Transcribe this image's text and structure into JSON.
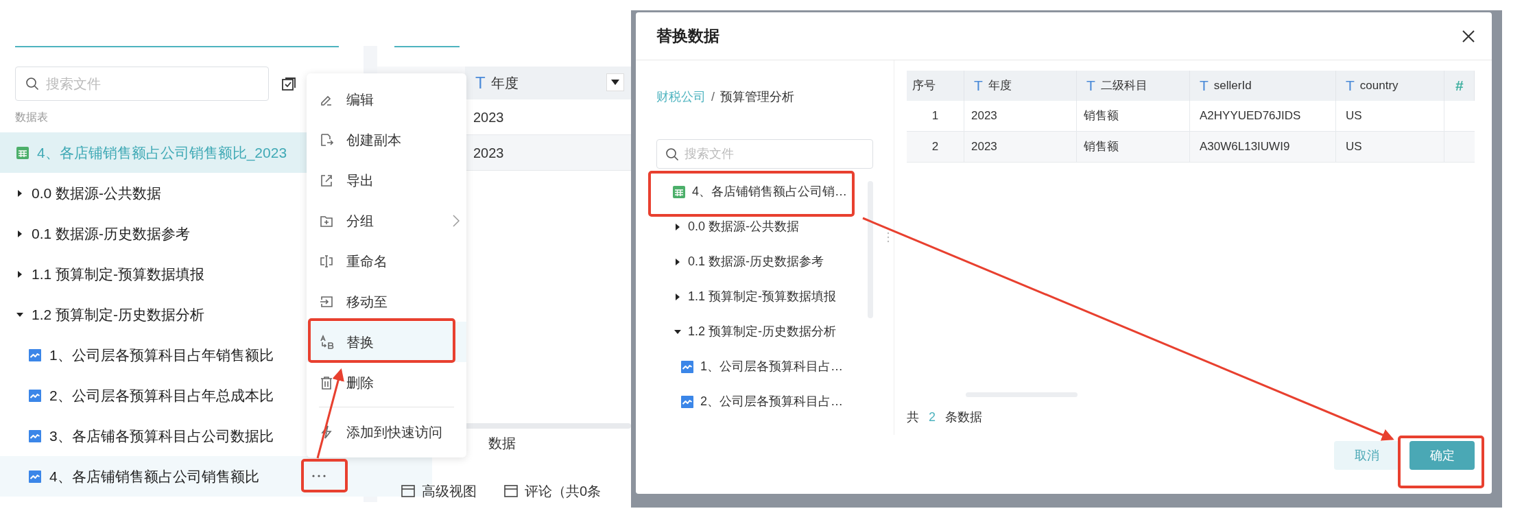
{
  "left_panel": {
    "search": {
      "placeholder": "搜索文件"
    },
    "section_label": "数据表",
    "tree": [
      {
        "label": "4、各店铺销售额占公司销售额比_2023",
        "kind": "table",
        "selected": true
      },
      {
        "label": "0.0 数据源-公共数据",
        "kind": "folder",
        "expanded": false
      },
      {
        "label": "0.1 数据源-历史数据参考",
        "kind": "folder",
        "expanded": false
      },
      {
        "label": "1.1 预算制定-预算数据填报",
        "kind": "folder",
        "expanded": false
      },
      {
        "label": "1.2 预算制定-历史数据分析",
        "kind": "folder",
        "expanded": true,
        "children": [
          {
            "label": "1、公司层各预算科目占年销售额比",
            "kind": "chart",
            "selected": false
          },
          {
            "label": "2、公司层各预算科目占年总成本比",
            "kind": "chart",
            "selected": false
          },
          {
            "label": "3、各店铺各预算科目占公司数据比",
            "kind": "chart",
            "selected": false
          },
          {
            "label": "4、各店铺销售额占公司销售额比",
            "kind": "chart",
            "selected": true
          }
        ]
      }
    ]
  },
  "middle_panel": {
    "table": {
      "columns": [
        {
          "type_icon": "T",
          "label": "年度"
        }
      ],
      "rows": [
        [
          "2023"
        ],
        [
          "2023"
        ]
      ]
    },
    "partial_text": "数据",
    "bottom_tabs": [
      "高级视图",
      "评论（共0条"
    ]
  },
  "context_menu": {
    "items": [
      {
        "label": "编辑",
        "kind": "edit",
        "selected": false
      },
      {
        "label": "创建副本",
        "kind": "copy",
        "selected": false
      },
      {
        "label": "导出",
        "kind": "export",
        "selected": false
      },
      {
        "label": "分组",
        "kind": "group",
        "selected": false,
        "submenu": true
      },
      {
        "label": "重命名",
        "kind": "rename",
        "selected": false
      },
      {
        "label": "移动至",
        "kind": "move",
        "selected": false
      },
      {
        "label": "替换",
        "kind": "replace",
        "selected": true
      },
      {
        "label": "删除",
        "kind": "delete",
        "selected": false
      },
      {
        "label": "添加到快速访问",
        "kind": "quick_access",
        "selected": false,
        "divider_before": true
      }
    ]
  },
  "dialog": {
    "title": "替换数据",
    "breadcrumb": [
      "财税公司",
      "预算管理分析"
    ],
    "breadcrumb_separator": "/",
    "search": {
      "placeholder": "搜索文件"
    },
    "tree": [
      {
        "label": "4、各店铺销售额占公司销…",
        "kind": "table"
      },
      {
        "label": "0.0 数据源-公共数据",
        "kind": "folder",
        "expanded": false
      },
      {
        "label": "0.1 数据源-历史数据参考",
        "kind": "folder",
        "expanded": false
      },
      {
        "label": "1.1 预算制定-预算数据填报",
        "kind": "folder",
        "expanded": false
      },
      {
        "label": "1.2 预算制定-历史数据分析",
        "kind": "folder",
        "expanded": true,
        "children": [
          {
            "label": "1、公司层各预算科目占…",
            "kind": "chart"
          },
          {
            "label": "2、公司层各预算科目占…",
            "kind": "chart"
          }
        ]
      }
    ],
    "table": {
      "columns": [
        {
          "label": "序号"
        },
        {
          "type_icon": "T",
          "label": "年度"
        },
        {
          "type_icon": "T",
          "label": "二级科目"
        },
        {
          "type_icon": "T",
          "label": "sellerId"
        },
        {
          "type_icon": "T",
          "label": "country"
        },
        {
          "type_icon": "#"
        }
      ],
      "rows": [
        [
          "1",
          "2023",
          "销售额",
          "A2HYYUED76JIDS",
          "US"
        ],
        [
          "2",
          "2023",
          "销售额",
          "A30W6L13IUWI9",
          "US"
        ]
      ]
    },
    "count": {
      "prefix": "共",
      "value": "2",
      "suffix": "条数据"
    },
    "buttons": [
      {
        "label": "取消",
        "kind": "secondary"
      },
      {
        "label": "确定",
        "kind": "primary"
      }
    ]
  }
}
